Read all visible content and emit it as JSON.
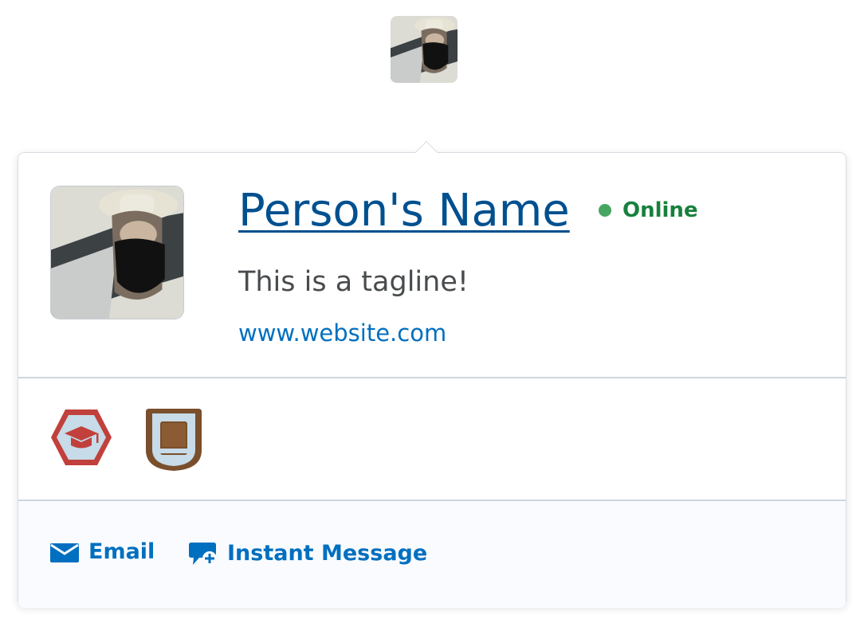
{
  "profile": {
    "name": "Person's Name",
    "status": "Online",
    "tagline": "This is a tagline!",
    "website": "www.website.com"
  },
  "awards": [
    {
      "icon": "graduation-cap-icon",
      "shape": "hexagon"
    },
    {
      "icon": "book-icon",
      "shape": "shield"
    }
  ],
  "actions": {
    "email_label": "Email",
    "im_label": "Instant Message"
  },
  "colors": {
    "link": "#006fbf",
    "name": "#00508f",
    "status_text": "#17803d",
    "status_dot": "#46a661",
    "tagline": "#494c4e",
    "footer_bg": "#f9fbff",
    "award_hexagon": "#c1403b",
    "award_shield": "#7a4f2b"
  }
}
